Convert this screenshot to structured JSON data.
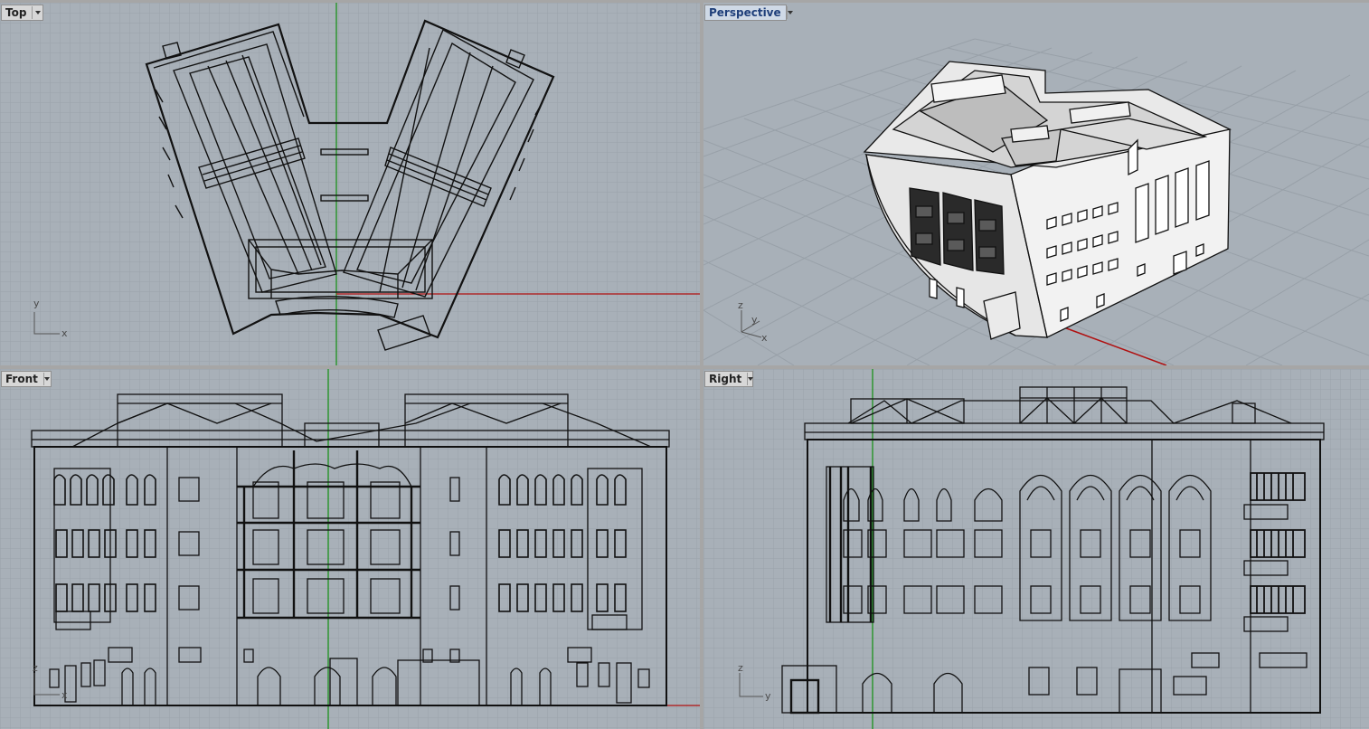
{
  "viewports": {
    "top": {
      "title": "Top",
      "axis_h": "x",
      "axis_v": "y"
    },
    "perspective": {
      "title": "Perspective",
      "axis_x": "x",
      "axis_y": "y",
      "axis_z": "z"
    },
    "front": {
      "title": "Front",
      "axis_h": "x",
      "axis_v": "z"
    },
    "right": {
      "title": "Right",
      "axis_h": "y",
      "axis_v": "z"
    }
  },
  "colors": {
    "viewport_bg": "#a8b0b8",
    "grid_minor": "#9aa2aa",
    "grid_major": "#8d959d",
    "x_axis": "#b01010",
    "y_axis": "#109010",
    "active_title_bg": "#cfd9e6"
  }
}
